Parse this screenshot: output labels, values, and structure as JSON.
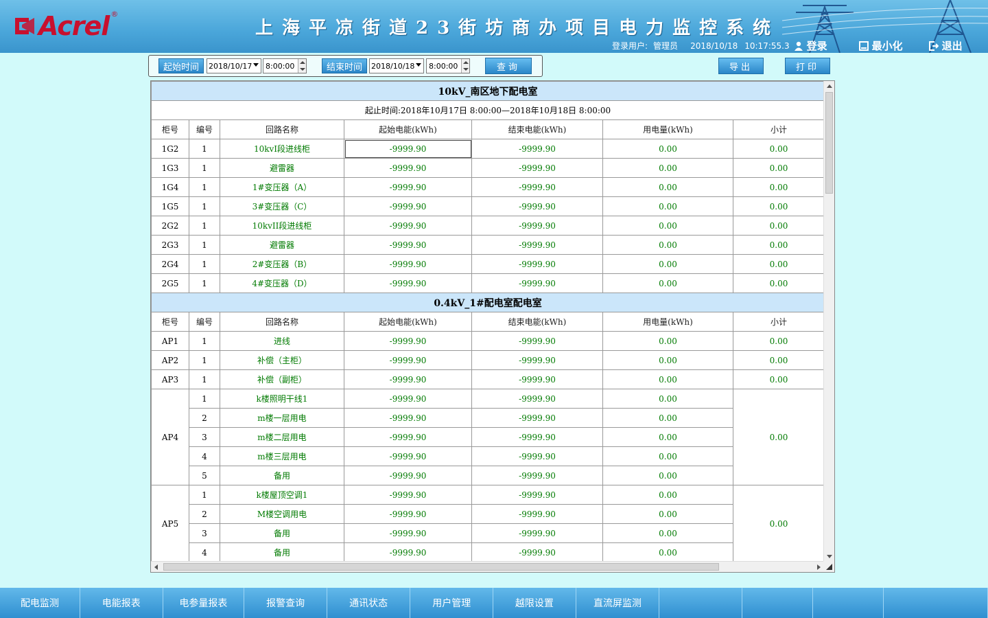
{
  "header": {
    "logo_text": "Acrel",
    "logo_reg": "®",
    "title": "上海平凉街道23街坊商办项目电力监控系统",
    "user_label": "登录用户:",
    "user_name": "管理员",
    "date": "2018/10/18",
    "time": "10:17:55.3",
    "login_label": "登录",
    "minimize_label": "最小化",
    "exit_label": "退出"
  },
  "query": {
    "start_label": "起始时间",
    "start_date": "2018/10/17",
    "start_time": "8:00:00",
    "end_label": "结束时间",
    "end_date": "2018/10/18",
    "end_time": "8:00:00",
    "query_label": "查询",
    "export_label": "导出",
    "print_label": "打印"
  },
  "columns": [
    "柜号",
    "编号",
    "回路名称",
    "起始电能(kWh)",
    "结束电能(kWh)",
    "用电量(kWh)",
    "小计"
  ],
  "section1": {
    "title": "10kV_南区地下配电室",
    "range": "起止时间:2018年10月17日 8:00:00—2018年10月18日 8:00:00",
    "rows": [
      {
        "cab": "1G2",
        "no": "1",
        "name": "10kvI段进线柜",
        "start": "-9999.90",
        "end": "-9999.90",
        "usage": "0.00",
        "sub": "0.00"
      },
      {
        "cab": "1G3",
        "no": "1",
        "name": "避雷器",
        "start": "-9999.90",
        "end": "-9999.90",
        "usage": "0.00",
        "sub": "0.00"
      },
      {
        "cab": "1G4",
        "no": "1",
        "name": "1#变压器（A）",
        "start": "-9999.90",
        "end": "-9999.90",
        "usage": "0.00",
        "sub": "0.00"
      },
      {
        "cab": "1G5",
        "no": "1",
        "name": "3#变压器（C）",
        "start": "-9999.90",
        "end": "-9999.90",
        "usage": "0.00",
        "sub": "0.00"
      },
      {
        "cab": "2G2",
        "no": "1",
        "name": "10kvII段进线柜",
        "start": "-9999.90",
        "end": "-9999.90",
        "usage": "0.00",
        "sub": "0.00"
      },
      {
        "cab": "2G3",
        "no": "1",
        "name": "避雷器",
        "start": "-9999.90",
        "end": "-9999.90",
        "usage": "0.00",
        "sub": "0.00"
      },
      {
        "cab": "2G4",
        "no": "1",
        "name": "2#变压器（B）",
        "start": "-9999.90",
        "end": "-9999.90",
        "usage": "0.00",
        "sub": "0.00"
      },
      {
        "cab": "2G5",
        "no": "1",
        "name": "4#变压器（D）",
        "start": "-9999.90",
        "end": "-9999.90",
        "usage": "0.00",
        "sub": "0.00"
      }
    ]
  },
  "section2": {
    "title": "0.4kV_1#配电室配电室",
    "rows_single": [
      {
        "cab": "AP1",
        "no": "1",
        "name": "进线",
        "start": "-9999.90",
        "end": "-9999.90",
        "usage": "0.00",
        "sub": "0.00"
      },
      {
        "cab": "AP2",
        "no": "1",
        "name": "补偿（主柜）",
        "start": "-9999.90",
        "end": "-9999.90",
        "usage": "0.00",
        "sub": "0.00"
      },
      {
        "cab": "AP3",
        "no": "1",
        "name": "补偿（副柜）",
        "start": "-9999.90",
        "end": "-9999.90",
        "usage": "0.00",
        "sub": "0.00"
      }
    ],
    "ap4": {
      "cab": "AP4",
      "sub": "0.00",
      "rows": [
        {
          "no": "1",
          "name": "k楼照明干线1",
          "start": "-9999.90",
          "end": "-9999.90",
          "usage": "0.00"
        },
        {
          "no": "2",
          "name": "m楼一层用电",
          "start": "-9999.90",
          "end": "-9999.90",
          "usage": "0.00"
        },
        {
          "no": "3",
          "name": "m楼二层用电",
          "start": "-9999.90",
          "end": "-9999.90",
          "usage": "0.00"
        },
        {
          "no": "4",
          "name": "m楼三层用电",
          "start": "-9999.90",
          "end": "-9999.90",
          "usage": "0.00"
        },
        {
          "no": "5",
          "name": "备用",
          "start": "-9999.90",
          "end": "-9999.90",
          "usage": "0.00"
        }
      ]
    },
    "ap5": {
      "cab": "AP5",
      "sub": "0.00",
      "rows": [
        {
          "no": "1",
          "name": "k楼屋顶空调1",
          "start": "-9999.90",
          "end": "-9999.90",
          "usage": "0.00"
        },
        {
          "no": "2",
          "name": "M楼空调用电",
          "start": "-9999.90",
          "end": "-9999.90",
          "usage": "0.00"
        },
        {
          "no": "3",
          "name": "备用",
          "start": "-9999.90",
          "end": "-9999.90",
          "usage": "0.00"
        },
        {
          "no": "4",
          "name": "备用",
          "start": "-9999.90",
          "end": "-9999.90",
          "usage": "0.00"
        }
      ]
    }
  },
  "nav": [
    "配电监测",
    "电能报表",
    "电参量报表",
    "报警查询",
    "通讯状态",
    "用户管理",
    "越限设置",
    "直流屏监测",
    "",
    "",
    "",
    ""
  ],
  "colors": {
    "accent": "#2a86c8",
    "background": "#d2fafa",
    "value_green": "#007a00",
    "section_bg": "#cbe6fa",
    "logo_red": "#c8102e"
  }
}
